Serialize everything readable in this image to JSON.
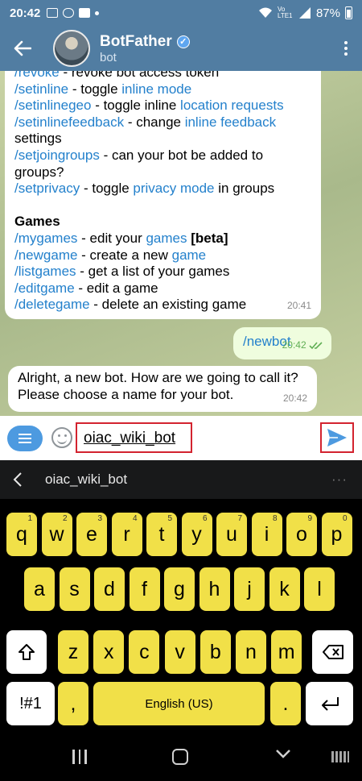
{
  "status_bar": {
    "time": "20:42",
    "battery": "87%",
    "network": "Vo LTE1"
  },
  "header": {
    "title": "BotFather",
    "subtitle": "bot"
  },
  "messages": {
    "help_lines": [
      [
        {
          "t": "/revoke",
          "c": "cmd"
        },
        {
          "t": " - revoke bot access token",
          "c": ""
        }
      ],
      [
        {
          "t": "/setinline",
          "c": "cmd"
        },
        {
          "t": " - toggle ",
          "c": ""
        },
        {
          "t": "inline mode",
          "c": "lnk"
        }
      ],
      [
        {
          "t": "/setinlinegeo",
          "c": "cmd"
        },
        {
          "t": " - toggle inline ",
          "c": ""
        },
        {
          "t": "location requests",
          "c": "lnk"
        }
      ],
      [
        {
          "t": "/setinlinefeedback",
          "c": "cmd"
        },
        {
          "t": " - change ",
          "c": ""
        },
        {
          "t": "inline feedback",
          "c": "lnk"
        }
      ],
      [
        {
          "t": "settings",
          "c": ""
        }
      ],
      [
        {
          "t": "/setjoingroups",
          "c": "cmd"
        },
        {
          "t": " - can your bot be added to",
          "c": ""
        }
      ],
      [
        {
          "t": "groups?",
          "c": ""
        }
      ],
      [
        {
          "t": "/setprivacy",
          "c": "cmd"
        },
        {
          "t": " - toggle ",
          "c": ""
        },
        {
          "t": "privacy mode",
          "c": "lnk"
        },
        {
          "t": " in groups",
          "c": ""
        }
      ],
      [
        {
          "t": "",
          "c": ""
        }
      ],
      [
        {
          "t": "Games",
          "c": "games-title"
        }
      ],
      [
        {
          "t": "/mygames",
          "c": "cmd"
        },
        {
          "t": " - edit your ",
          "c": ""
        },
        {
          "t": "games",
          "c": "lnk"
        },
        {
          "t": " [beta]",
          "c": "games-title"
        }
      ],
      [
        {
          "t": "/newgame",
          "c": "cmd"
        },
        {
          "t": " - create a new ",
          "c": ""
        },
        {
          "t": "game",
          "c": "lnk"
        }
      ],
      [
        {
          "t": "/listgames",
          "c": "cmd"
        },
        {
          "t": " - get a list of your games",
          "c": ""
        }
      ],
      [
        {
          "t": "/editgame",
          "c": "cmd"
        },
        {
          "t": " - edit a game",
          "c": ""
        }
      ],
      [
        {
          "t": "/deletegame",
          "c": "cmd"
        },
        {
          "t": " - delete an existing game",
          "c": ""
        }
      ]
    ],
    "help_time": "20:41",
    "outgoing_text": "/newbot",
    "outgoing_time": "20:42",
    "reply_line1": "Alright, a new bot. How are we going to call it?",
    "reply_line2": "Please choose a name for your bot.",
    "reply_time": "20:42"
  },
  "input": {
    "value": "oiac_wiki_bot"
  },
  "suggestion": {
    "word": "oiac_wiki_bot",
    "more": "···"
  },
  "keyboard": {
    "row1": [
      {
        "k": "q",
        "n": "1"
      },
      {
        "k": "w",
        "n": "2"
      },
      {
        "k": "e",
        "n": "3"
      },
      {
        "k": "r",
        "n": "4"
      },
      {
        "k": "t",
        "n": "5"
      },
      {
        "k": "y",
        "n": "6"
      },
      {
        "k": "u",
        "n": "7"
      },
      {
        "k": "i",
        "n": "8"
      },
      {
        "k": "o",
        "n": "9"
      },
      {
        "k": "p",
        "n": "0"
      }
    ],
    "row2": [
      "a",
      "s",
      "d",
      "f",
      "g",
      "h",
      "j",
      "k",
      "l"
    ],
    "row3": [
      "z",
      "x",
      "c",
      "v",
      "b",
      "n",
      "m"
    ],
    "symbols_label": "!#1",
    "comma_label": ",",
    "space_label": "English (US)",
    "period_label": "."
  },
  "colors": {
    "header": "#517da2",
    "key": "#f1e048",
    "link": "#2481cc",
    "outgoing_bubble": "#effdde",
    "highlight_box": "#d3232f"
  }
}
